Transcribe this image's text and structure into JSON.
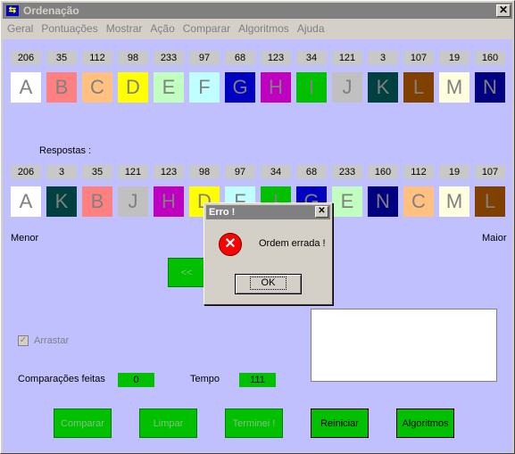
{
  "window": {
    "title": "Ordenação",
    "close_label": "✕"
  },
  "menu": [
    "Geral",
    "Pontuações",
    "Mostrar",
    "Ação",
    "Comparar",
    "Algoritmos",
    "Ajuda"
  ],
  "top_row": [
    {
      "num": "206",
      "letter": "A",
      "bg": "#ffffff",
      "fg": "#808080"
    },
    {
      "num": "35",
      "letter": "B",
      "bg": "#ff8080",
      "fg": "#808080"
    },
    {
      "num": "112",
      "letter": "C",
      "bg": "#ffc080",
      "fg": "#808080"
    },
    {
      "num": "98",
      "letter": "D",
      "bg": "#ffff00",
      "fg": "#808080"
    },
    {
      "num": "233",
      "letter": "E",
      "bg": "#c0ffc0",
      "fg": "#808080"
    },
    {
      "num": "97",
      "letter": "F",
      "bg": "#c0ffff",
      "fg": "#808080"
    },
    {
      "num": "68",
      "letter": "G",
      "bg": "#0000c0",
      "fg": "#808080"
    },
    {
      "num": "123",
      "letter": "H",
      "bg": "#c000c0",
      "fg": "#808080"
    },
    {
      "num": "34",
      "letter": "I",
      "bg": "#00c000",
      "fg": "#808080"
    },
    {
      "num": "121",
      "letter": "J",
      "bg": "#c0c0c0",
      "fg": "#808080"
    },
    {
      "num": "3",
      "letter": "K",
      "bg": "#004040",
      "fg": "#808080"
    },
    {
      "num": "107",
      "letter": "L",
      "bg": "#804000",
      "fg": "#808080"
    },
    {
      "num": "19",
      "letter": "M",
      "bg": "#ffffe0",
      "fg": "#808080"
    },
    {
      "num": "160",
      "letter": "N",
      "bg": "#000080",
      "fg": "#808080"
    }
  ],
  "answers_label": "Respostas :",
  "answer_row": [
    {
      "num": "206",
      "letter": "A",
      "bg": "#ffffff",
      "fg": "#808080"
    },
    {
      "num": "3",
      "letter": "K",
      "bg": "#004040",
      "fg": "#808080"
    },
    {
      "num": "35",
      "letter": "B",
      "bg": "#ff8080",
      "fg": "#808080"
    },
    {
      "num": "121",
      "letter": "J",
      "bg": "#c0c0c0",
      "fg": "#808080"
    },
    {
      "num": "123",
      "letter": "H",
      "bg": "#c000c0",
      "fg": "#808080"
    },
    {
      "num": "98",
      "letter": "D",
      "bg": "#ffff00",
      "fg": "#808080"
    },
    {
      "num": "97",
      "letter": "F",
      "bg": "#c0ffff",
      "fg": "#808080"
    },
    {
      "num": "34",
      "letter": "I",
      "bg": "#00c000",
      "fg": "#808080"
    },
    {
      "num": "68",
      "letter": "G",
      "bg": "#0000c0",
      "fg": "#808080"
    },
    {
      "num": "233",
      "letter": "E",
      "bg": "#c0ffc0",
      "fg": "#808080"
    },
    {
      "num": "160",
      "letter": "N",
      "bg": "#000080",
      "fg": "#808080"
    },
    {
      "num": "112",
      "letter": "C",
      "bg": "#ffc080",
      "fg": "#808080"
    },
    {
      "num": "19",
      "letter": "M",
      "bg": "#ffffe0",
      "fg": "#808080"
    },
    {
      "num": "107",
      "letter": "L",
      "bg": "#804000",
      "fg": "#808080"
    }
  ],
  "labels": {
    "menor": "Menor",
    "maior": "Maior",
    "arrastar": "Arrastar",
    "comparacoes": "Comparações feitas",
    "tempo": "Tempo"
  },
  "values": {
    "comparacoes": "0",
    "tempo": "111"
  },
  "buttons": {
    "comparar": "Comparar",
    "limpar": "Limpar",
    "terminei": "Terminei !",
    "reiniciar": "Reiniciar",
    "algoritmos": "Algoritmos",
    "hidden": "<<"
  },
  "dialog": {
    "title": "Erro !",
    "message": "Ordem errada !",
    "ok": "OK",
    "close": "✕",
    "icon": "error-icon"
  }
}
